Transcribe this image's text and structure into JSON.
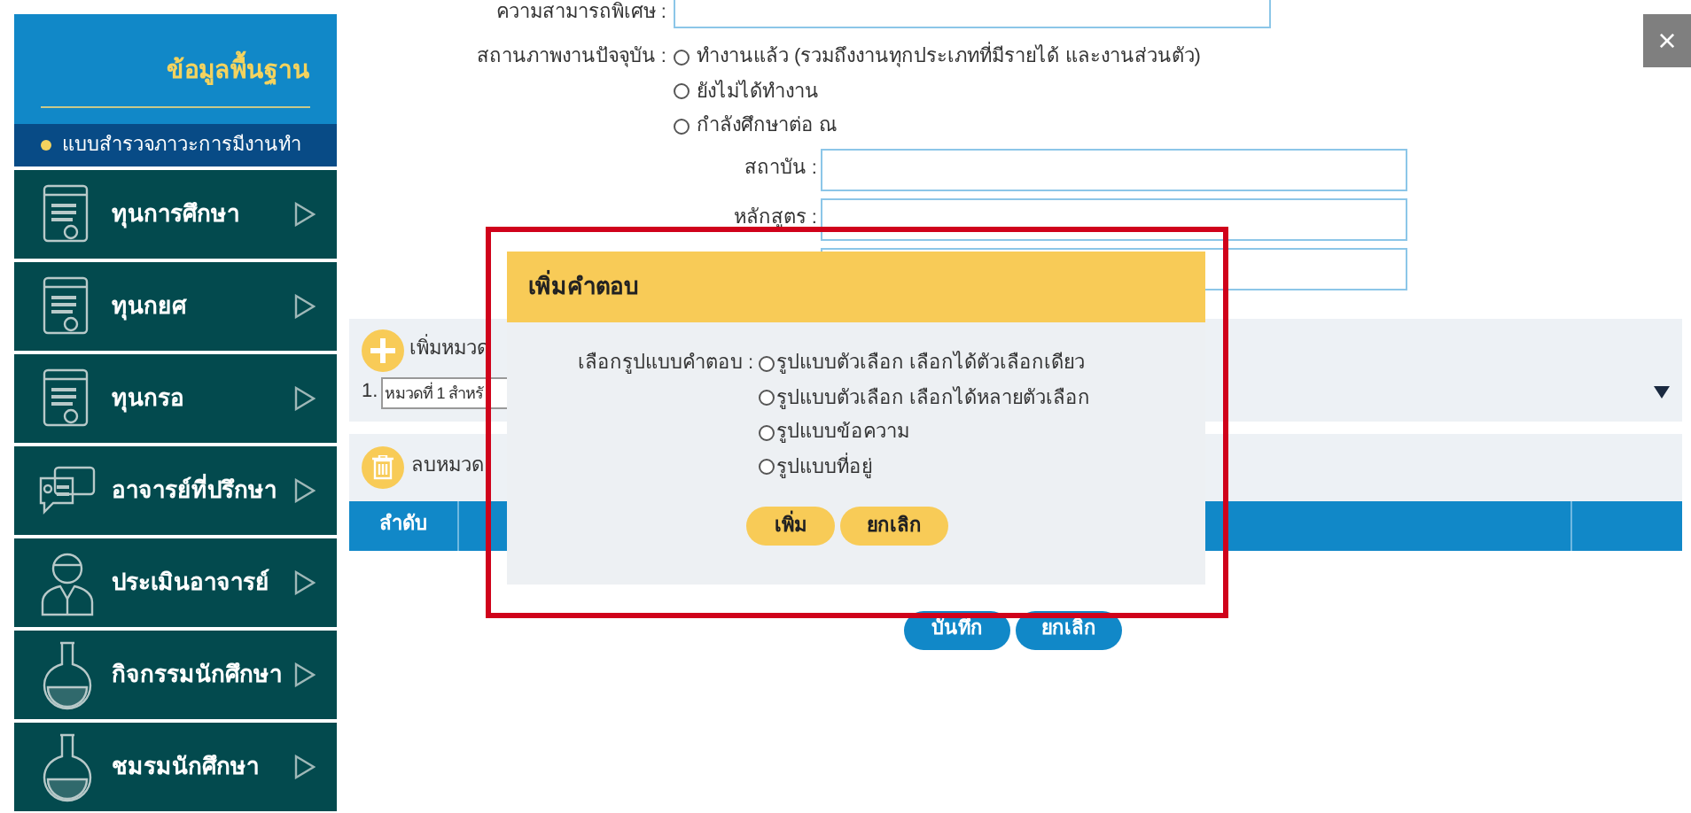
{
  "sidebar": {
    "header": "ข้อมูลพื้นฐาน",
    "subitem": {
      "label": "แบบสำรวจภาวะการมีงานทำ",
      "selected": true
    },
    "items": [
      {
        "label": "ทุนการศึกษา",
        "kind": "document"
      },
      {
        "label": "ทุนกยศ",
        "kind": "document"
      },
      {
        "label": "ทุนกรอ",
        "kind": "document"
      },
      {
        "label": "อาจารย์ที่ปรึกษา",
        "kind": "chat"
      },
      {
        "label": "ประเมินอาจารย์",
        "kind": "person"
      },
      {
        "label": "กิจกรรมนักศึกษา",
        "kind": "flask"
      },
      {
        "label": "ชมรมนักศึกษา",
        "kind": "flask"
      }
    ]
  },
  "form": {
    "skills_label": "ความสามารถพิเศษ :",
    "status_label": "สถานภาพงานปัจจุบัน :",
    "status_options": [
      {
        "label": "ทำงานแล้ว (รวมถึงงานทุกประเภทที่มีรายได้ และงานส่วนตัว)",
        "selected": false
      },
      {
        "label": "ยังไม่ได้ทำงาน",
        "selected": false
      },
      {
        "label": "กำลังศึกษาต่อ ณ",
        "selected": false
      }
    ],
    "fields": [
      {
        "kind": "input",
        "label": "สถาบัน :"
      },
      {
        "kind": "input",
        "label": "หลักสูตร :"
      },
      {
        "kind": "input"
      }
    ]
  },
  "category_panel": {
    "add_label": "เพิ่มหมวด",
    "row_number": "1.",
    "select_value": "หมวดที่ 1 สำหรั"
  },
  "delete_panel": {
    "delete_label": "ลบหมวด"
  },
  "table": {
    "columns": [
      "ลำดับ"
    ]
  },
  "buttons": [
    "บันทึก",
    "ยกเลิก"
  ],
  "modal": {
    "title": "เพิ่มคำตอบ",
    "prompt": "เลือกรูปแบบคำตอบ :",
    "options": [
      {
        "label": "รูปแบบตัวเลือก เลือกได้ตัวเลือกเดียว",
        "selected": false
      },
      {
        "label": "รูปแบบตัวเลือก เลือกได้หลายตัวเลือก",
        "selected": false
      },
      {
        "label": "รูปแบบข้อความ",
        "selected": false
      },
      {
        "label": "รูปแบบที่อยู่",
        "selected": false
      }
    ],
    "buttons": [
      "เพิ่ม",
      "ยกเลิก"
    ]
  },
  "close_label": "×"
}
